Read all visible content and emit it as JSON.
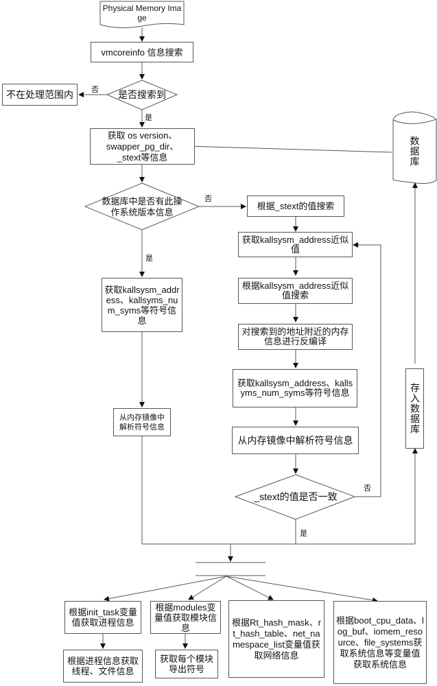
{
  "diagram": {
    "start": "Physical Memory Image",
    "vmcoreinfo_search": "vmcoreinfo 信息搜索",
    "found_decision": "是否搜索到",
    "out_of_scope": "不在处理范围内",
    "get_os_info": "获取 os version、swapper_pg_dir、_stext等信息",
    "db_decision": "数据库中是否有此操作系统版本信息",
    "database": "数据库",
    "search_by_stext": "根据_stext的值搜索",
    "get_kallsyms_approx": "获取kallsysm_address近似值",
    "get_kallsyms_from_db": "获取kallsysm_address、kallsyms_num_syms等符号信息",
    "search_by_approx": "根据kallsysm_address近似值搜索",
    "disassemble": "对搜索到的地址附近的内存信息进行反编译",
    "get_kallsyms_right": "获取kallsysm_address、kallsyms_num_syms等符号信息",
    "parse_symbols_left": "从内存镜像中解析符号信息",
    "parse_symbols_right": "从内存镜像中解析符号信息",
    "stext_decision": "_stext的值是否一致",
    "store_db": "存入数据库",
    "process_info": "根据init_task变量值获取进程信息",
    "module_info": "根据modules变量值获取模块信息",
    "network_info": "根据Rt_hash_mask、rt_hash_table、net_namespace_list变量值获取网络信息",
    "system_info": "根据boot_cpu_data、log_buf、iomem_resource、file_systems获取系统信息等变量值获取系统信息",
    "thread_file_info": "根据进程信息获取线程、文件信息",
    "module_symbols": "获取每个模块导出符号",
    "labels": {
      "yes": "是",
      "no": "否"
    }
  }
}
